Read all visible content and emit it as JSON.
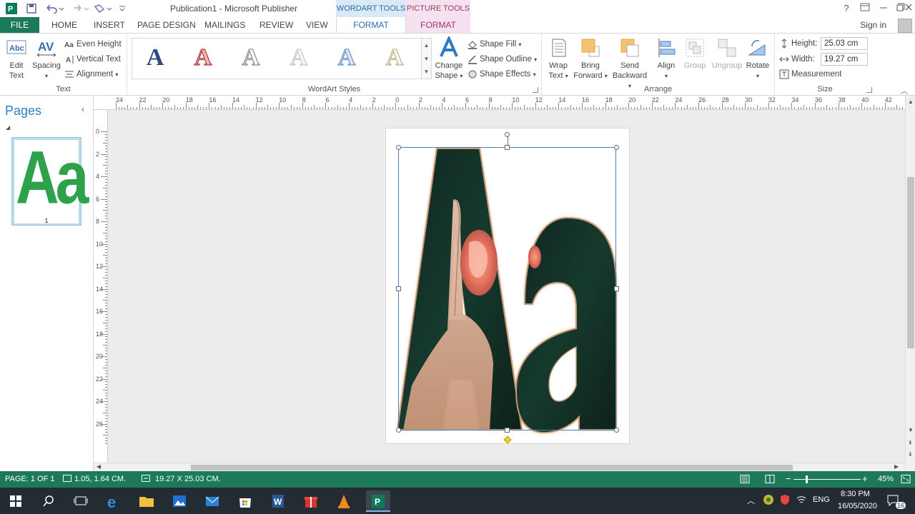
{
  "window": {
    "title": "Publication1 - Microsoft Publisher",
    "context_tabs": {
      "wordart": "WORDART TOOLS",
      "picture": "PICTURE TOOLS"
    },
    "controls": {
      "help": "?"
    }
  },
  "tabs": {
    "file": "FILE",
    "items": [
      "HOME",
      "INSERT",
      "PAGE DESIGN",
      "MAILINGS",
      "REVIEW",
      "VIEW"
    ],
    "wordart_format": "FORMAT",
    "picture_format": "FORMAT",
    "sign_in": "Sign in"
  },
  "ribbon": {
    "text_group": {
      "label": "Text",
      "edit_text": [
        "Edit",
        "Text"
      ],
      "spacing": "Spacing",
      "even_height": "Even Height",
      "vertical_text": "Vertical Text",
      "alignment": "Alignment"
    },
    "wordart_styles": {
      "label": "WordArt Styles",
      "change_shape": [
        "Change",
        "Shape"
      ],
      "shape_fill": "Shape Fill",
      "shape_outline": "Shape Outline",
      "shape_effects": "Shape Effects"
    },
    "arrange": {
      "label": "Arrange",
      "wrap_text": [
        "Wrap",
        "Text"
      ],
      "bring_forward": [
        "Bring",
        "Forward"
      ],
      "send_backward": [
        "Send",
        "Backward"
      ],
      "align": "Align",
      "group": "Group",
      "ungroup": "Ungroup",
      "rotate": "Rotate"
    },
    "size": {
      "label": "Size",
      "height_label": "Height:",
      "height_value": "25.03 cm",
      "width_label": "Width:",
      "width_value": "19.27 cm",
      "measurement": "Measurement"
    }
  },
  "pages_pane": {
    "title": "Pages",
    "thumbnail_text": "Aa",
    "page_number": "1"
  },
  "canvas": {
    "wordart_text": "Aa"
  },
  "rulers": {
    "horizontal": [
      "24",
      "22",
      "20",
      "18",
      "16",
      "14",
      "12",
      "10",
      "8",
      "6",
      "4",
      "2",
      "0",
      "2",
      "4",
      "6",
      "8",
      "10",
      "12",
      "14",
      "16",
      "18",
      "20",
      "22",
      "24",
      "26",
      "28",
      "30",
      "32",
      "34",
      "36",
      "38",
      "40",
      "42",
      "44"
    ],
    "vertical": [
      "0",
      "2",
      "4",
      "6",
      "8",
      "10",
      "12",
      "14",
      "16",
      "18",
      "20",
      "22",
      "24",
      "26"
    ]
  },
  "status_bar": {
    "page": "PAGE: 1 OF 1",
    "position": "1.05, 1.64 CM.",
    "size": "19.27 X 25.03 CM.",
    "zoom": "45%"
  },
  "taskbar": {
    "language": "ENG",
    "time": "8:30 PM",
    "date": "16/05/2020",
    "notifications": "16"
  }
}
